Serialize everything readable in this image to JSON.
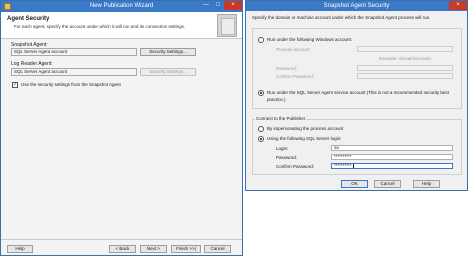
{
  "wizard": {
    "title": "New Publication Wizard",
    "page_title": "Agent Security",
    "page_description": "For each agent, specify the account under which it will run and its connection settings.",
    "snapshot_agent": {
      "label": "Snapshot Agent:",
      "account": "SQL Server Agent account",
      "settings_button": "Security Settings..."
    },
    "log_reader_agent": {
      "label": "Log Reader Agent:",
      "account": "SQL Server Agent account",
      "settings_button": "Security Settings..."
    },
    "use_same_settings": {
      "label": "Use the security settings from the Snapshot Agent",
      "checked": true
    },
    "buttons": {
      "help": "Help",
      "back": "< Back",
      "next": "Next >",
      "finish": "Finish >>|",
      "cancel": "Cancel"
    }
  },
  "dialog": {
    "title": "Snapshot Agent Security",
    "description": "Specify the domain or machine account under which the Snapshot Agent process will run.",
    "run_under_windows": {
      "label": "Run under the following Windows account:",
      "selected": false,
      "process_account_label": "Process account:",
      "process_account_value": "",
      "example_hint": "Example: domain\\account",
      "password_label": "Password:",
      "confirm_password_label": "Confirm Password:"
    },
    "run_under_agent": {
      "label_line1": "Run under the SQL Server Agent service account (This is not a recommended security best",
      "label_line2": "practice.)",
      "selected": true
    },
    "connect_group_label": "Connect to the Publisher",
    "impersonate": {
      "label": "By impersonating the process account",
      "selected": false
    },
    "sql_login": {
      "label": "Using the following SQL Server login:",
      "selected": true,
      "login_label": "Login:",
      "login_value": "sa",
      "password_label": "Password:",
      "password_value": "**********",
      "confirm_password_label": "Confirm Password:",
      "confirm_password_value": "**********"
    },
    "buttons": {
      "ok": "OK",
      "cancel": "Cancel",
      "help": "Help"
    }
  },
  "colors": {
    "titlebar": "#3a78c8",
    "close_button": "#c7392b"
  },
  "icons": {
    "close": "×",
    "minimize": "—",
    "maximize": "□",
    "check": "✓"
  }
}
